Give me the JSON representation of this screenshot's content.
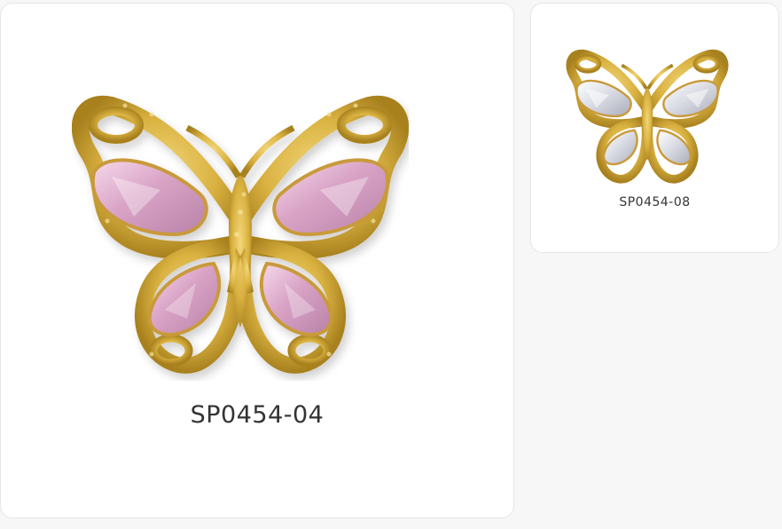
{
  "products": [
    {
      "sku": "SP0454-04",
      "image": "gold-butterfly-charm-pink-rhinestones",
      "stone_color": "#e8b4d6",
      "metal_color": "#d4af37"
    },
    {
      "sku": "SP0454-08",
      "image": "gold-butterfly-charm-clear-rhinestones",
      "stone_color": "#d9dbe3",
      "metal_color": "#d4af37"
    }
  ]
}
